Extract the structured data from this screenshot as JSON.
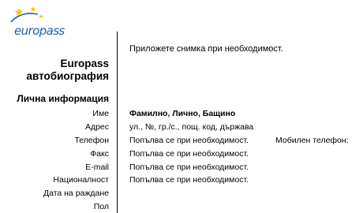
{
  "logo": {
    "brand_part1": "euro",
    "brand_part2": "pass",
    "star_color": "#f5c400",
    "text_color": "#1e5fa8",
    "icon": "europass-stars-icon"
  },
  "photo_note": "Приложете снимка при необходимост.",
  "title": {
    "line1": "Europass",
    "line2": "автобиография"
  },
  "personal_info": {
    "heading": "Лична информация",
    "rows": [
      {
        "label": "Име",
        "value": "Фамилно, Лично, Бащино"
      },
      {
        "label": "Адрес",
        "value": "ул., №, гр./с., пощ. код, държава"
      },
      {
        "label": "Телефон",
        "value": "Попълва се при необходимост.",
        "extra_label": "Мобилен телефон:"
      },
      {
        "label": "Факс",
        "value": "Попълва се при необходимост."
      },
      {
        "label": "E-mail",
        "value": "Попълва се при необходимост."
      },
      {
        "label": "Националност",
        "value": "Попълва се при необходимост."
      },
      {
        "label": "Дата на раждане",
        "value": ""
      },
      {
        "label": "Пол",
        "value": ""
      }
    ]
  }
}
